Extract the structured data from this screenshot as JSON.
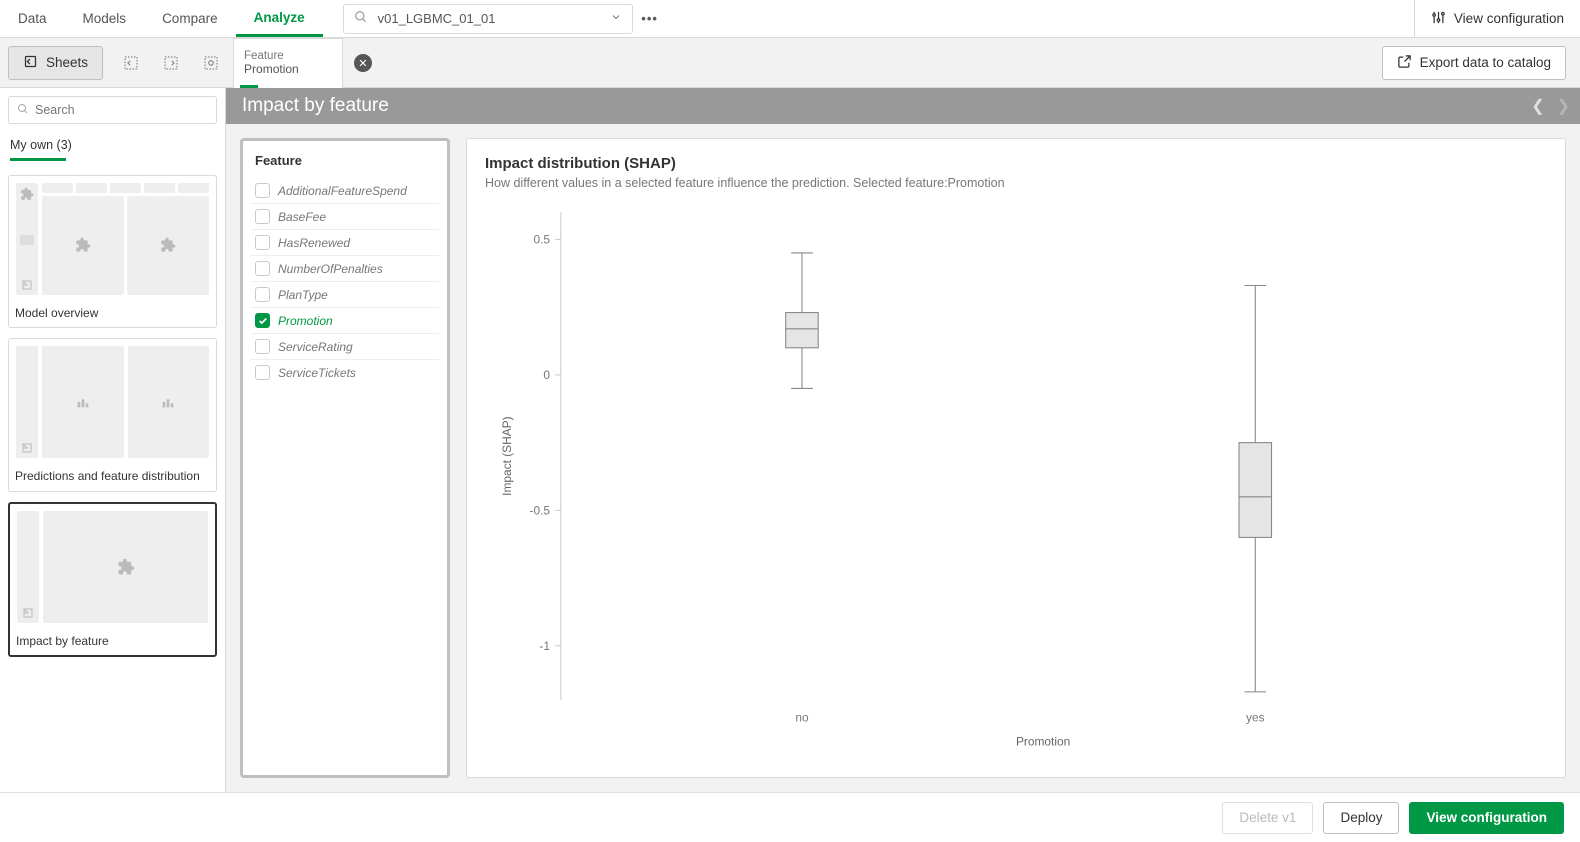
{
  "topnav": {
    "tabs": [
      "Data",
      "Models",
      "Compare",
      "Analyze"
    ],
    "active": "Analyze",
    "search_value": "v01_LGBMC_01_01",
    "view_config": "View configuration"
  },
  "secbar": {
    "sheets": "Sheets",
    "feature_tab_label": "Feature",
    "feature_tab_value": "Promotion",
    "export": "Export data to catalog"
  },
  "left": {
    "search_placeholder": "Search",
    "myown": "My own (3)",
    "sheets": [
      {
        "label": "Model overview"
      },
      {
        "label": "Predictions and feature distribution"
      },
      {
        "label": "Impact by feature"
      }
    ],
    "selected": 2
  },
  "impact_header": "Impact by feature",
  "feature_panel": {
    "heading": "Feature",
    "items": [
      "AdditionalFeatureSpend",
      "BaseFee",
      "HasRenewed",
      "NumberOfPenalties",
      "PlanType",
      "Promotion",
      "ServiceRating",
      "ServiceTickets"
    ],
    "selected": "Promotion"
  },
  "chart": {
    "title": "Impact distribution (SHAP)",
    "subtitle": "How different values in a selected feature influence the prediction. Selected feature:Promotion",
    "ylabel": "Impact (SHAP)",
    "xlabel": "Promotion"
  },
  "chart_data": {
    "type": "box",
    "xlabel": "Promotion",
    "ylabel": "Impact (SHAP)",
    "ylim": [
      -1.2,
      0.6
    ],
    "yticks": [
      0.5,
      0,
      -0.5,
      -1
    ],
    "categories": [
      "no",
      "yes"
    ],
    "series": [
      {
        "name": "no",
        "min": -0.05,
        "q1": 0.1,
        "median": 0.17,
        "q3": 0.23,
        "max": 0.45
      },
      {
        "name": "yes",
        "min": -1.17,
        "q1": -0.6,
        "median": -0.45,
        "q3": -0.25,
        "max": 0.33
      }
    ]
  },
  "footer": {
    "delete": "Delete v1",
    "deploy": "Deploy",
    "viewconf": "View configuration"
  }
}
